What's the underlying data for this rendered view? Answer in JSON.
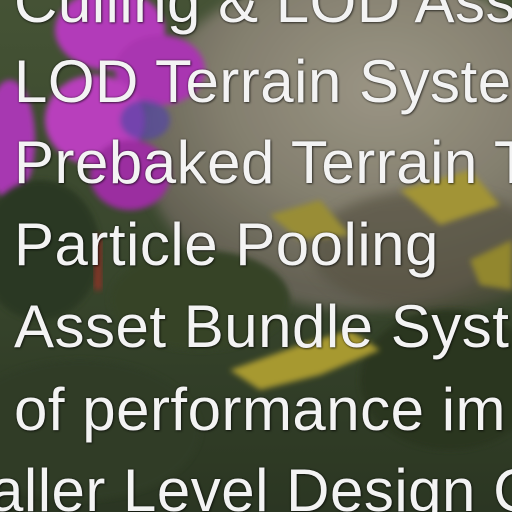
{
  "lines": [
    "Culling & LOD Asset",
    "LOD Terrain System",
    "Prebaked Terrain T",
    "Particle Pooling",
    "Asset Bundle Syst",
    "of performance im",
    "aller Level Design C"
  ],
  "colors": {
    "text": "#f3f3f3",
    "background_grass": "#3b4a2e",
    "background_rock": "#8f8a78",
    "flower_magenta": "#c23fc9",
    "plant_yellow": "#b6a635"
  }
}
